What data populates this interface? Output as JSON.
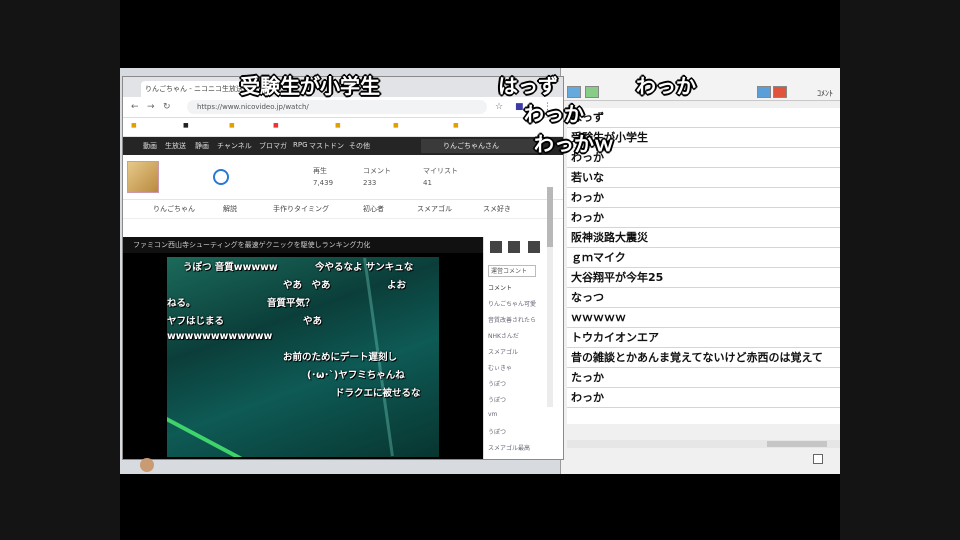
{
  "overlay_comments": [
    "受験生が小学生",
    "はっず",
    "わっか",
    "わっか",
    "わっかｗ"
  ],
  "browser": {
    "tab_title": "りんごちゃん - ニコニコ生放送",
    "url": "https://www.nicovideo.jp/watch/",
    "nav_items": [
      "動画",
      "生放送",
      "静画",
      "チャンネル",
      "ブロマガ",
      "RPG",
      "マストドン",
      "その他"
    ],
    "user_name": "りんごちゃんさん",
    "info_labels": [
      "再生",
      "コメント",
      "マイリスト"
    ],
    "info_values": [
      "7,439",
      "233",
      "41"
    ],
    "tags": [
      "りんごちゃん",
      "解説",
      "手作りタイミング",
      "初心者",
      "スメアゴル",
      "スメ好き"
    ],
    "player_title": "ファミコン西山寺シューティングを最速ゲクニックを駆使しランキング力化",
    "video_comments": [
      "うぽつ 音質wwwww",
      "今やるなよ サンキュな",
      "やあ　やあ",
      "よお",
      "ねる。",
      "音質平気？",
      "ヤフはじまる",
      "やあ",
      "wwwwwwwwwwww",
      "お前のためにデート遅刻し",
      "(･ω･`)ヤフミちゃんね",
      "ドラクエに被せるな"
    ],
    "panel_input": "運営コメント",
    "panel_header": "コメント",
    "panel_items": [
      "りんごちゃん可愛",
      "音質改善されたら",
      "NHKさんだ",
      "スメアゴル",
      "むぃきゃ",
      "うぽつ",
      "うぽつ",
      "vm",
      "うぽつ",
      "スメアゴル最高"
    ]
  },
  "viewer": {
    "toolbar_label": "ｺﾒﾝﾄ",
    "comments": [
      "はっず",
      "受験生が小学生",
      "わっか",
      "若いな",
      "わっか",
      "わっか",
      "阪神淡路大震災",
      "ｇｍマイク",
      "大谷翔平が今年25",
      "なっつ",
      "ｗｗｗｗｗ",
      "トウカイオンエア",
      "昔の雑談とかあんま覚えてないけど赤西のは覚えて",
      "たっか",
      "わっか"
    ]
  }
}
